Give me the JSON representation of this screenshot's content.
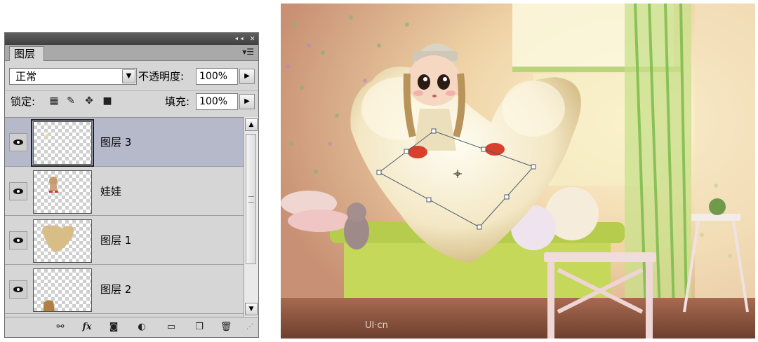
{
  "panel": {
    "window_buttons": "◂◂ ✕",
    "tab_label": "图层",
    "blend_mode": "正常",
    "opacity_label": "不透明度:",
    "opacity_value": "100%",
    "lock_label": "锁定:",
    "fill_label": "填充:",
    "fill_value": "100%",
    "layers": [
      {
        "name": "图层 3",
        "selected": true
      },
      {
        "name": "娃娃",
        "selected": false
      },
      {
        "name": "图层 1",
        "selected": false
      },
      {
        "name": "图层 2",
        "selected": false
      }
    ],
    "bottom_icons": [
      "link-layers-icon",
      "fx-icon",
      "add-mask-icon",
      "adjustment-layer-icon",
      "group-folder-icon",
      "new-layer-icon",
      "delete-layer-icon"
    ],
    "fx_label": "fx"
  },
  "canvas": {
    "watermark": "UI·cn"
  },
  "colors": {
    "panel_bg": "#d6d6d6",
    "selected_row": "#b6b9c9",
    "titlebar": "#4a4a4a"
  }
}
